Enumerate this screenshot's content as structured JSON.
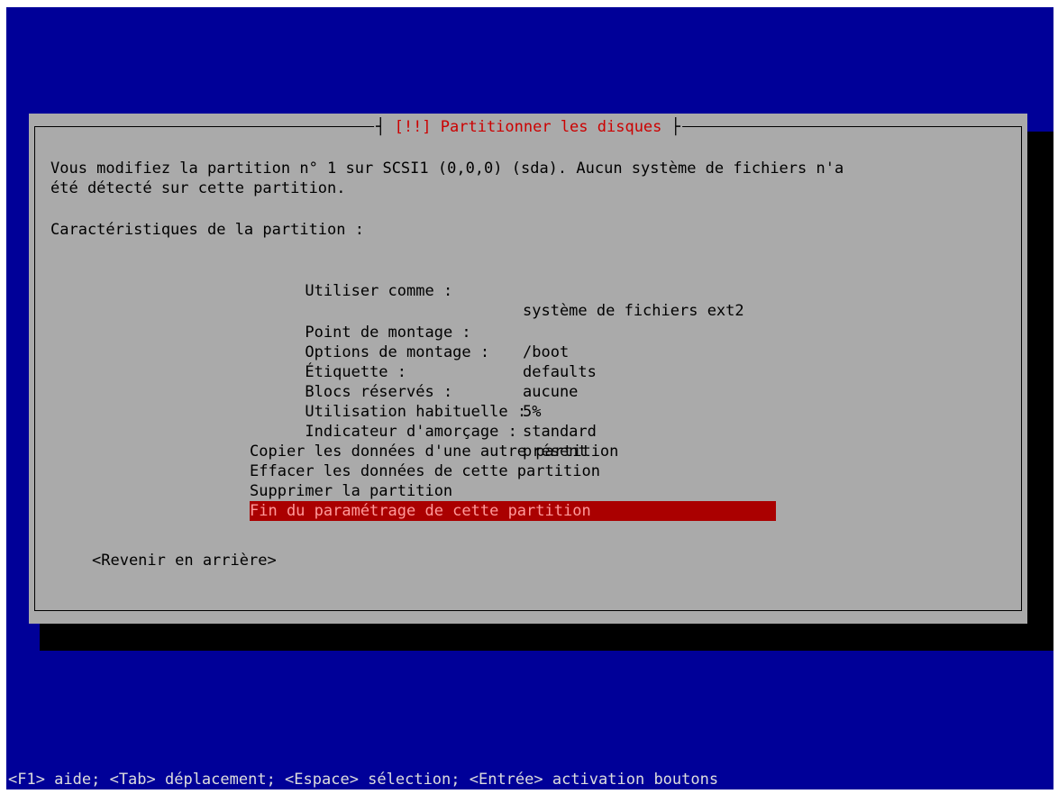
{
  "dialog": {
    "title": "[!!] Partitionner les disques",
    "intro_line1": "Vous modifiez la partition n° 1 sur SCSI1 (0,0,0) (sda). Aucun système de fichiers n'a",
    "intro_line2": "été détecté sur cette partition.",
    "section_heading": "Caractéristiques de la partition :",
    "properties": [
      {
        "label": "Utiliser comme :",
        "value": "système de fichiers ext2"
      },
      {
        "label": "Point de montage :",
        "value": "/boot"
      },
      {
        "label": "Options de montage :",
        "value": "defaults"
      },
      {
        "label": "Étiquette :",
        "value": "aucune"
      },
      {
        "label": "Blocs réservés :",
        "value": "5%"
      },
      {
        "label": "Utilisation habituelle :",
        "value": "standard"
      },
      {
        "label": "Indicateur d'amorçage :",
        "value": "présent"
      }
    ],
    "actions": [
      "Copier les données d'une autre partition",
      "Effacer les données de cette partition",
      "Supprimer la partition",
      "Fin du paramétrage de cette partition"
    ],
    "back_button": "<Revenir en arrière>"
  },
  "status_bar": "<F1> aide; <Tab> déplacement; <Espace> sélection; <Entrée> activation boutons",
  "colors": {
    "background": "#000098",
    "dialog": "#aaaaaa",
    "title": "#cc0000",
    "selection": "#aa0000"
  }
}
